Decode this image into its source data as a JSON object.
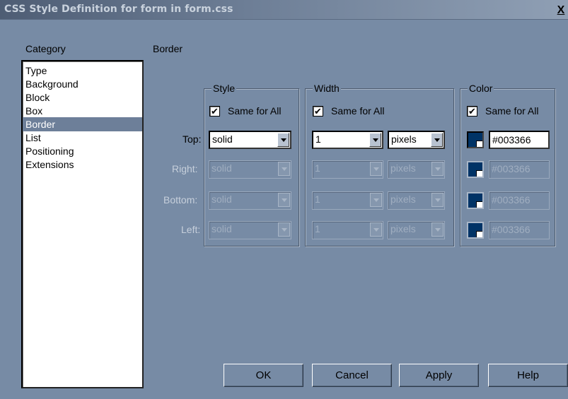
{
  "window": {
    "title": "CSS Style Definition for form in form.css",
    "close_label": "X"
  },
  "category": {
    "header": "Category",
    "items": [
      "Type",
      "Background",
      "Block",
      "Box",
      "Border",
      "List",
      "Positioning",
      "Extensions"
    ],
    "selected": "Border"
  },
  "panel": {
    "title": "Border"
  },
  "style_group": {
    "title": "Style",
    "same_for_all_label": "Same for All",
    "same_for_all_checked": true,
    "top": "solid",
    "right": "solid",
    "bottom": "solid",
    "left": "solid"
  },
  "width_group": {
    "title": "Width",
    "same_for_all_label": "Same for All",
    "same_for_all_checked": true,
    "top": "1",
    "top_unit": "pixels",
    "right": "1",
    "right_unit": "pixels",
    "bottom": "1",
    "bottom_unit": "pixels",
    "left": "1",
    "left_unit": "pixels"
  },
  "color_group": {
    "title": "Color",
    "same_for_all_label": "Same for All",
    "same_for_all_checked": true,
    "top": "#003366",
    "right": "#003366",
    "bottom": "#003366",
    "left": "#003366",
    "swatch_color": "#003366"
  },
  "rows": {
    "top": "Top:",
    "right": "Right:",
    "bottom": "Bottom:",
    "left": "Left:"
  },
  "buttons": {
    "ok": "OK",
    "cancel": "Cancel",
    "apply": "Apply",
    "help": "Help"
  },
  "check_glyph": "✔"
}
